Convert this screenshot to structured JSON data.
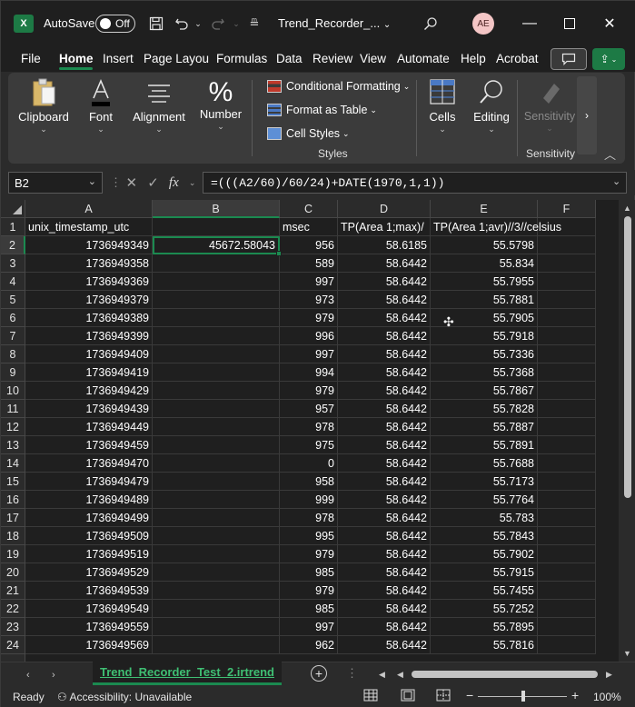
{
  "titlebar": {
    "logo": "X",
    "autosave_label": "AutoSave",
    "toggle_state": "Off",
    "doc_title": "Trend_Recorder_...",
    "avatar_initials": "AE"
  },
  "tabs": [
    "File",
    "Home",
    "Insert",
    "Page Layout",
    "Formulas",
    "Data",
    "Review",
    "View",
    "Automate",
    "Help",
    "Acrobat"
  ],
  "ribbon": {
    "clipboard": "Clipboard",
    "font": "Font",
    "alignment": "Alignment",
    "number": "Number",
    "conditional_formatting": "Conditional Formatting",
    "format_as_table": "Format as Table",
    "cell_styles": "Cell Styles",
    "styles_group": "Styles",
    "cells": "Cells",
    "editing": "Editing",
    "sensitivity": "Sensitivity",
    "sensitivity_group": "Sensitivity"
  },
  "formula_bar": {
    "name_box": "B2",
    "fx": "fx",
    "formula": "=(((A2/60)/60/24)+DATE(1970,1,1))"
  },
  "columns": [
    "A",
    "B",
    "C",
    "D",
    "E",
    "F"
  ],
  "header_row": [
    "unix_timestamp_utc",
    "",
    "msec",
    "TP(Area 1;max)/",
    "TP(Area 1;avr)//3//celsius",
    ""
  ],
  "rows": [
    {
      "n": "2",
      "a": "1736949349",
      "b": "45672.58043",
      "c": "956",
      "d": "58.6185",
      "e": "55.5798"
    },
    {
      "n": "3",
      "a": "1736949358",
      "b": "",
      "c": "589",
      "d": "58.6442",
      "e": "55.834"
    },
    {
      "n": "4",
      "a": "1736949369",
      "b": "",
      "c": "997",
      "d": "58.6442",
      "e": "55.7955"
    },
    {
      "n": "5",
      "a": "1736949379",
      "b": "",
      "c": "973",
      "d": "58.6442",
      "e": "55.7881"
    },
    {
      "n": "6",
      "a": "1736949389",
      "b": "",
      "c": "979",
      "d": "58.6442",
      "e": "55.7905"
    },
    {
      "n": "7",
      "a": "1736949399",
      "b": "",
      "c": "996",
      "d": "58.6442",
      "e": "55.7918"
    },
    {
      "n": "8",
      "a": "1736949409",
      "b": "",
      "c": "997",
      "d": "58.6442",
      "e": "55.7336"
    },
    {
      "n": "9",
      "a": "1736949419",
      "b": "",
      "c": "994",
      "d": "58.6442",
      "e": "55.7368"
    },
    {
      "n": "10",
      "a": "1736949429",
      "b": "",
      "c": "979",
      "d": "58.6442",
      "e": "55.7867"
    },
    {
      "n": "11",
      "a": "1736949439",
      "b": "",
      "c": "957",
      "d": "58.6442",
      "e": "55.7828"
    },
    {
      "n": "12",
      "a": "1736949449",
      "b": "",
      "c": "978",
      "d": "58.6442",
      "e": "55.7887"
    },
    {
      "n": "13",
      "a": "1736949459",
      "b": "",
      "c": "975",
      "d": "58.6442",
      "e": "55.7891"
    },
    {
      "n": "14",
      "a": "1736949470",
      "b": "",
      "c": "0",
      "d": "58.6442",
      "e": "55.7688"
    },
    {
      "n": "15",
      "a": "1736949479",
      "b": "",
      "c": "958",
      "d": "58.6442",
      "e": "55.7173"
    },
    {
      "n": "16",
      "a": "1736949489",
      "b": "",
      "c": "999",
      "d": "58.6442",
      "e": "55.7764"
    },
    {
      "n": "17",
      "a": "1736949499",
      "b": "",
      "c": "978",
      "d": "58.6442",
      "e": "55.783"
    },
    {
      "n": "18",
      "a": "1736949509",
      "b": "",
      "c": "995",
      "d": "58.6442",
      "e": "55.7843"
    },
    {
      "n": "19",
      "a": "1736949519",
      "b": "",
      "c": "979",
      "d": "58.6442",
      "e": "55.7902"
    },
    {
      "n": "20",
      "a": "1736949529",
      "b": "",
      "c": "985",
      "d": "58.6442",
      "e": "55.7915"
    },
    {
      "n": "21",
      "a": "1736949539",
      "b": "",
      "c": "979",
      "d": "58.6442",
      "e": "55.7455"
    },
    {
      "n": "22",
      "a": "1736949549",
      "b": "",
      "c": "985",
      "d": "58.6442",
      "e": "55.7252"
    },
    {
      "n": "23",
      "a": "1736949559",
      "b": "",
      "c": "997",
      "d": "58.6442",
      "e": "55.7895"
    },
    {
      "n": "24",
      "a": "1736949569",
      "b": "",
      "c": "962",
      "d": "58.6442",
      "e": "55.7816"
    }
  ],
  "sheet": {
    "tab_name": "Trend_Recorder_Test_2.irtrend"
  },
  "status": {
    "ready": "Ready",
    "accessibility": "Accessibility: Unavailable",
    "zoom": "100%"
  }
}
